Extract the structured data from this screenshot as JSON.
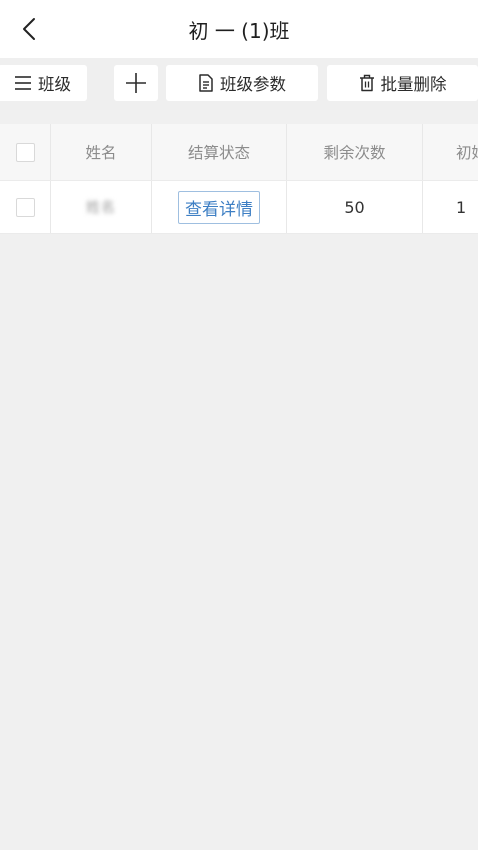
{
  "header": {
    "title": "初 一 (1)班",
    "back_icon": "chevron-left-icon"
  },
  "toolbar": {
    "class_menu_label": "班级",
    "class_menu_icon": "menu-icon",
    "add_icon": "plus-icon",
    "class_params_label": "班级参数",
    "class_params_icon": "document-icon",
    "batch_delete_label": "批量删除",
    "batch_delete_icon": "trash-icon"
  },
  "table": {
    "columns": [
      "姓名",
      "结算状态",
      "剩余次数",
      "初始"
    ],
    "rows": [
      {
        "name": "姓名",
        "status_action": "查看详情",
        "remaining": "50",
        "initial": "1"
      }
    ]
  },
  "colors": {
    "background": "#f0f0f0",
    "link_blue": "#3e7fc4",
    "header_text": "#8c8c8c"
  }
}
